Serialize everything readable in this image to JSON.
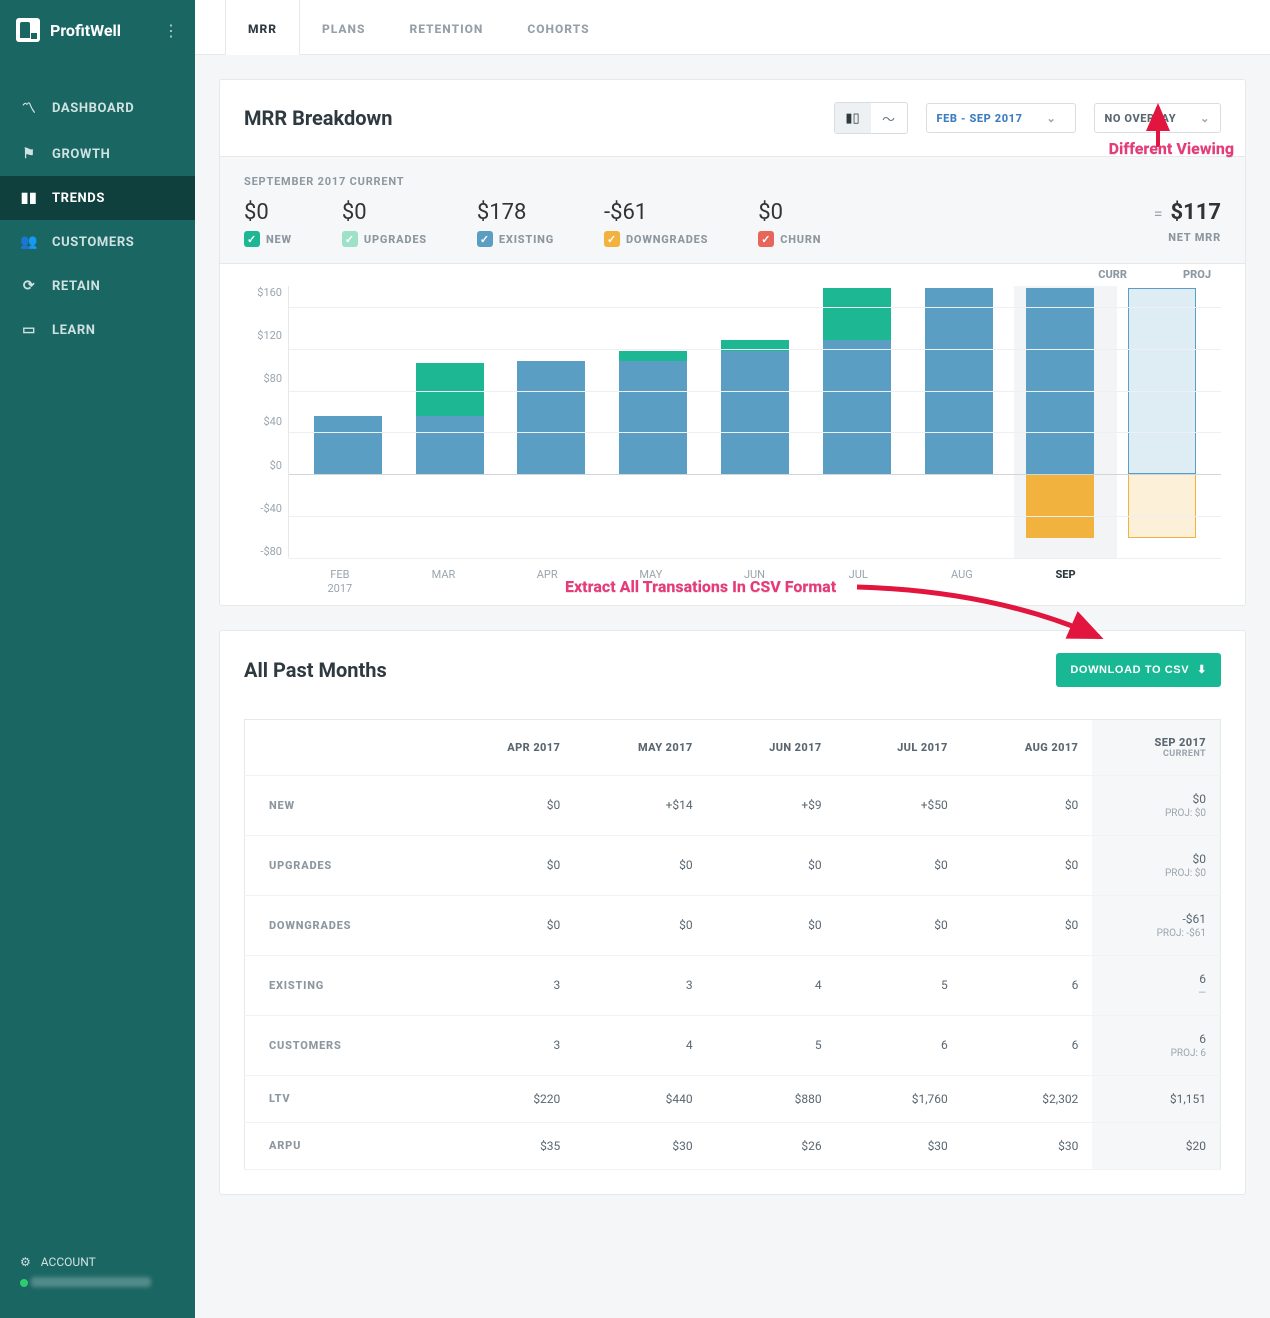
{
  "brand": {
    "name": "ProfitWell"
  },
  "sidebar": {
    "items": [
      {
        "label": "DASHBOARD"
      },
      {
        "label": "GROWTH"
      },
      {
        "label": "TRENDS"
      },
      {
        "label": "CUSTOMERS"
      },
      {
        "label": "RETAIN"
      },
      {
        "label": "LEARN"
      }
    ],
    "account_label": "ACCOUNT"
  },
  "tabs": [
    {
      "label": "MRR",
      "active": true
    },
    {
      "label": "PLANS"
    },
    {
      "label": "RETENTION"
    },
    {
      "label": "COHORTS"
    }
  ],
  "breakdown": {
    "title": "MRR Breakdown",
    "date_range": "FEB - SEP 2017",
    "overlay_label": "NO OVERLAY",
    "period_label": "SEPTEMBER 2017 CURRENT",
    "stats": {
      "new": {
        "value": "$0",
        "label": "NEW"
      },
      "upgrades": {
        "value": "$0",
        "label": "UPGRADES"
      },
      "existing": {
        "value": "$178",
        "label": "EXISTING"
      },
      "downgrades": {
        "value": "-$61",
        "label": "DOWNGRADES"
      },
      "churn": {
        "value": "$0",
        "label": "CHURN"
      }
    },
    "net": {
      "value": "$117",
      "label": "NET MRR"
    },
    "chart_top_labels": {
      "curr": "CURR",
      "proj": "PROJ"
    }
  },
  "annotations": {
    "viewing": "Different Viewing",
    "csv": "Extract All Transations In CSV Format"
  },
  "chart_data": {
    "type": "bar",
    "stacked": true,
    "categories": [
      "FEB 2017",
      "MAR",
      "APR",
      "MAY",
      "JUN",
      "JUL",
      "AUG",
      "SEP",
      "PROJ"
    ],
    "ylim": [
      -80,
      180
    ],
    "yticks": [
      "$160",
      "$120",
      "$80",
      "$40",
      "$0",
      "-$40",
      "-$80"
    ],
    "series": [
      {
        "name": "existing",
        "color": "#5b9ec4",
        "values": [
          56,
          56,
          108,
          108,
          118,
          128,
          178,
          178,
          178
        ]
      },
      {
        "name": "new",
        "color": "#1eb794",
        "values": [
          0,
          50,
          0,
          10,
          10,
          50,
          0,
          0,
          0
        ]
      },
      {
        "name": "downgrades",
        "color": "#f2b23e",
        "values": [
          0,
          0,
          0,
          0,
          0,
          0,
          0,
          -61,
          -61
        ]
      }
    ],
    "projection_index": 8,
    "current_index": 7
  },
  "past_months": {
    "title": "All Past Months",
    "download_label": "DOWNLOAD TO CSV",
    "columns": [
      {
        "label": "APR 2017"
      },
      {
        "label": "MAY 2017"
      },
      {
        "label": "JUN 2017"
      },
      {
        "label": "JUL 2017"
      },
      {
        "label": "AUG 2017"
      },
      {
        "label": "SEP 2017",
        "sub": "CURRENT"
      }
    ],
    "rows": [
      {
        "label": "NEW",
        "cells": [
          "$0",
          "+$14",
          "+$9",
          "+$50",
          "$0"
        ],
        "last": "$0",
        "proj": "PROJ: $0"
      },
      {
        "label": "UPGRADES",
        "cells": [
          "$0",
          "$0",
          "$0",
          "$0",
          "$0"
        ],
        "last": "$0",
        "proj": "PROJ: $0"
      },
      {
        "label": "DOWNGRADES",
        "cells": [
          "$0",
          "$0",
          "$0",
          "$0",
          "$0"
        ],
        "last": "-$61",
        "proj": "PROJ: -$61"
      },
      {
        "label": "EXISTING",
        "cells": [
          "3",
          "3",
          "4",
          "5",
          "6"
        ],
        "last": "6",
        "proj": "—"
      },
      {
        "label": "CUSTOMERS",
        "cells": [
          "3",
          "4",
          "5",
          "6",
          "6"
        ],
        "last": "6",
        "proj": "PROJ: 6"
      },
      {
        "label": "LTV",
        "cells": [
          "$220",
          "$440",
          "$880",
          "$1,760",
          "$2,302"
        ],
        "last": "$1,151",
        "proj": ""
      },
      {
        "label": "ARPU",
        "cells": [
          "$35",
          "$30",
          "$26",
          "$30",
          "$30"
        ],
        "last": "$20",
        "proj": ""
      }
    ]
  }
}
